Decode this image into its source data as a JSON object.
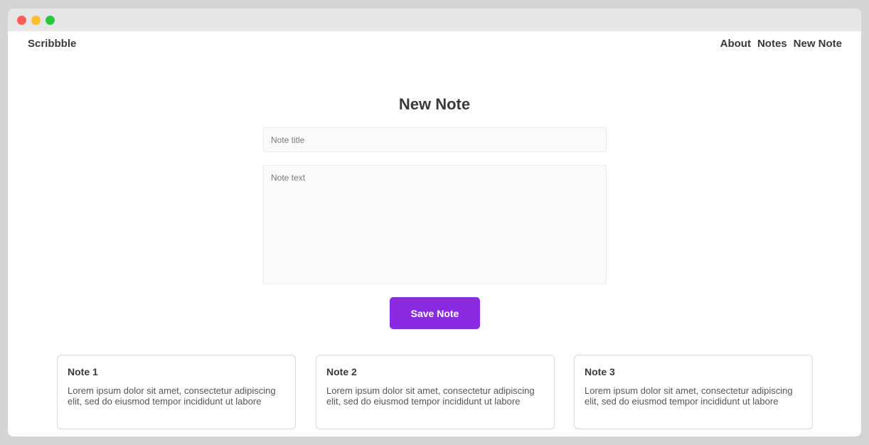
{
  "nav": {
    "brand": "Scribbble",
    "links": [
      "About",
      "Notes",
      "New Note"
    ]
  },
  "form": {
    "heading": "New Note",
    "title_placeholder": "Note title",
    "text_placeholder": "Note text",
    "save_label": "Save Note"
  },
  "notes": [
    {
      "title": "Note 1",
      "body": "Lorem ipsum dolor sit amet, consectetur adipiscing elit, sed do eiusmod tempor incididunt ut labore"
    },
    {
      "title": "Note 2",
      "body": "Lorem ipsum dolor sit amet, consectetur adipiscing elit, sed do eiusmod tempor incididunt ut labore"
    },
    {
      "title": "Note 3",
      "body": "Lorem ipsum dolor sit amet, consectetur adipiscing elit, sed do eiusmod tempor incididunt ut labore"
    }
  ],
  "colors": {
    "accent": "#8a2be2",
    "close": "#ff5f57",
    "minimize": "#febc2e",
    "maximize": "#28c840"
  }
}
